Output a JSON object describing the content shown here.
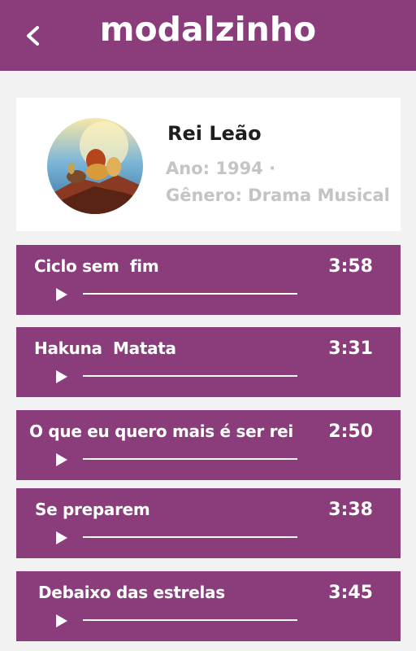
{
  "header": {
    "title": "modalzinho",
    "back_icon": "chevron-left-icon"
  },
  "colors": {
    "brand": "#8a3d7a",
    "background": "#f2f2f2",
    "meta_text": "#c4c4c4"
  },
  "movie": {
    "title": "Rei Leão",
    "year_text": "Ano: 1994 ·",
    "genre_text": "Gênero: Drama Musical",
    "poster_icon": "movie-poster-image"
  },
  "tracks": [
    {
      "title": "Ciclo sem  fim",
      "duration": "3:58",
      "progress": 0
    },
    {
      "title": "Hakuna  Matata",
      "duration": "3:31",
      "progress": 0
    },
    {
      "title": "O que eu quero mais é ser rei",
      "duration": "2:50",
      "progress": 0
    },
    {
      "title": "Se preparem",
      "duration": "3:38",
      "progress": 0
    },
    {
      "title": "Debaixo das estrelas",
      "duration": "3:45",
      "progress": 0
    }
  ]
}
